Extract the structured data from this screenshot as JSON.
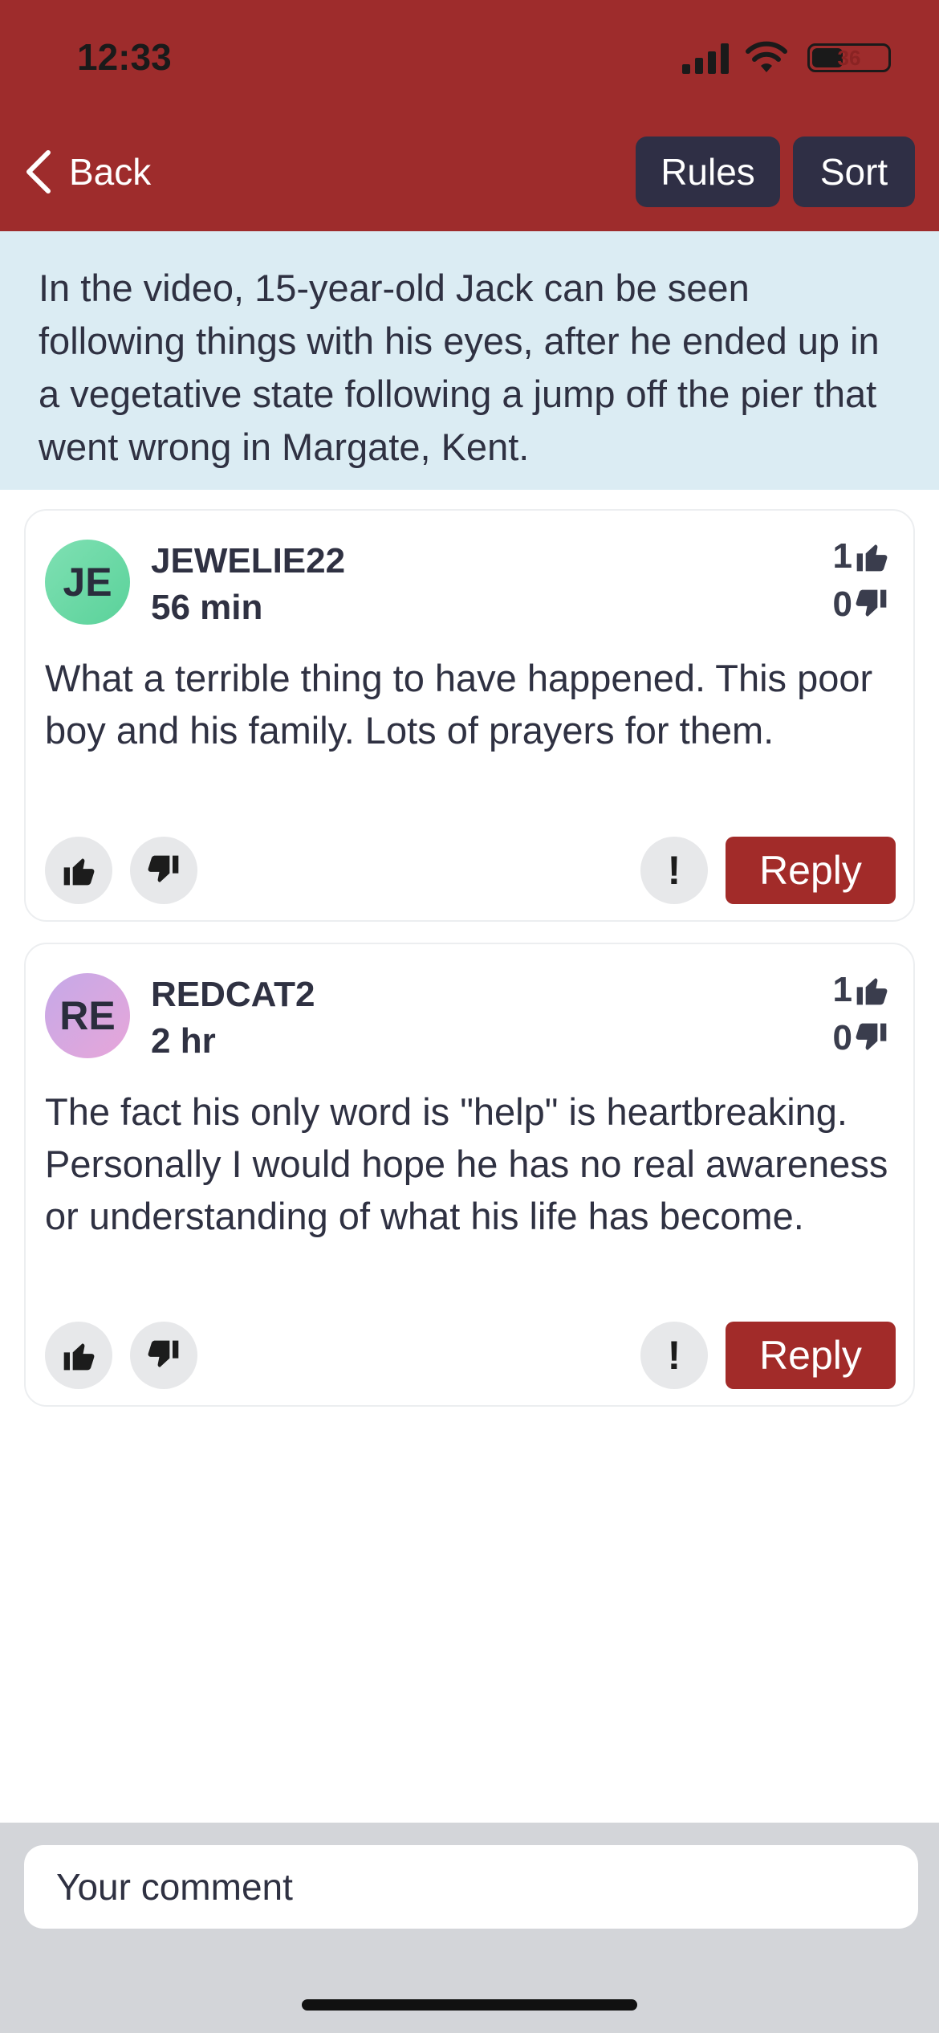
{
  "status_bar": {
    "time": "12:33",
    "battery": "36"
  },
  "nav": {
    "back_label": "Back",
    "rules_label": "Rules",
    "sort_label": "Sort"
  },
  "article_summary": "In the video, 15-year-old Jack can be seen following things with his eyes, after he ended up in a vegetative state following a jump off the pier that went wrong in Margate, Kent.",
  "comments": [
    {
      "initials": "JE",
      "username": "JEWELIE22",
      "time": "56 min",
      "likes": "1",
      "dislikes": "0",
      "text": "What a terrible thing to have happened. This poor boy and his family. Lots of prayers for them.",
      "report_label": "!",
      "reply_label": "Reply",
      "avatar_colors": [
        "#7fe0b3",
        "#5ad29a"
      ]
    },
    {
      "initials": "RE",
      "username": "REDCAT2",
      "time": "2 hr",
      "likes": "1",
      "dislikes": "0",
      "text": "The fact his only word is \"help\" is heartbreaking. Personally I would hope he has no real awareness or understanding of what his life has become.",
      "report_label": "!",
      "reply_label": "Reply",
      "avatar_colors": [
        "#c5a9e8",
        "#e7a6d9"
      ]
    }
  ],
  "composer": {
    "placeholder": "Your comment"
  },
  "colors": {
    "header": "#9e2c2c",
    "button_dark": "#2f2f45",
    "reply": "#a22b29",
    "summary_bg": "#dbecf3"
  },
  "icons": [
    "back-chevron-icon",
    "signal-icon",
    "wifi-icon",
    "battery-icon",
    "thumbs-up-icon",
    "thumbs-down-icon"
  ]
}
